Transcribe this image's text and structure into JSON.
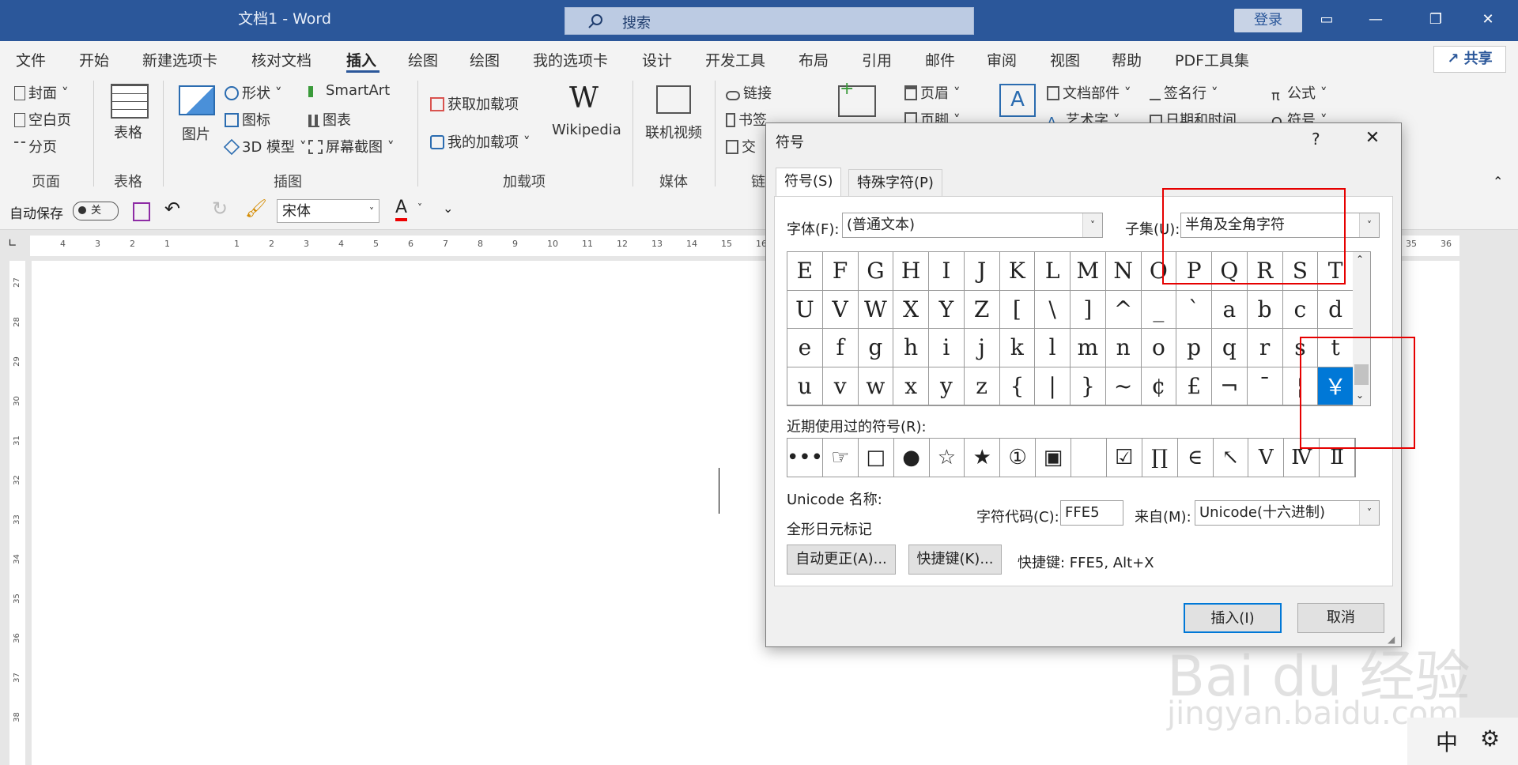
{
  "window": {
    "title": "文档1  -  Word",
    "search_placeholder": "搜索",
    "login": "登录",
    "share": "共享"
  },
  "ribbon": {
    "tabs": [
      "文件",
      "开始",
      "新建选项卡",
      "核对文档",
      "插入",
      "绘图",
      "绘图",
      "我的选项卡",
      "设计",
      "开发工具",
      "布局",
      "引用",
      "邮件",
      "审阅",
      "视图",
      "帮助",
      "PDF工具集"
    ],
    "active_tab": "插入",
    "pages_group": {
      "items": [
        "封面",
        "空白页",
        "分页"
      ],
      "label": "页面"
    },
    "table_group": {
      "item": "表格",
      "label": "表格"
    },
    "illus_group": {
      "picture": "图片",
      "shapes": "形状",
      "icons": "图标",
      "model3d": "3D 模型",
      "smartart": "SmartArt",
      "chart": "图表",
      "screenshot": "屏幕截图",
      "label": "插图"
    },
    "addins_group": {
      "get": "获取加载项",
      "mine": "我的加载项",
      "wiki": "Wikipedia",
      "label": "加载项"
    },
    "media_group": {
      "video": "联机视频",
      "label": "媒体"
    },
    "links_group": {
      "link": "链接",
      "bookmark": "书签",
      "cross": "交",
      "label": "链"
    },
    "header_group": {
      "header": "页眉",
      "footer": "页脚"
    },
    "text_group": {
      "parts": "文档部件",
      "wordart": "艺术字",
      "sign": "签名行",
      "datetime": "日期和时间"
    },
    "symbols_group": {
      "equation": "公式",
      "symbol": "符号"
    }
  },
  "qat": {
    "autosave": "自动保存",
    "toggle": "关",
    "font": "宋体"
  },
  "ruler": {
    "ticks": [
      "4",
      "3",
      "2",
      "1",
      "",
      "1",
      "2",
      "3",
      "4",
      "5",
      "6",
      "7",
      "8",
      "9",
      "10",
      "11",
      "12",
      "13",
      "14",
      "15",
      "16"
    ],
    "right_ticks": [
      "35",
      "36"
    ],
    "v_ticks": [
      "27",
      "28",
      "29",
      "30",
      "31",
      "32",
      "33",
      "34",
      "35",
      "36",
      "37",
      "38"
    ]
  },
  "dialog": {
    "title": "符号",
    "help": "?",
    "tabs": [
      "符号(S)",
      "特殊字符(P)"
    ],
    "font_label": "字体(F):",
    "font_value": "(普通文本)",
    "subset_label": "子集(U):",
    "subset_value": "半角及全角字符",
    "symbols": [
      "E",
      "F",
      "G",
      "H",
      "I",
      "J",
      "K",
      "L",
      "M",
      "N",
      "O",
      "P",
      "Q",
      "R",
      "S",
      "T",
      "U",
      "V",
      "W",
      "X",
      "Y",
      "Z",
      "[",
      "\\",
      "]",
      "^",
      "_",
      "`",
      "a",
      "b",
      "c",
      "d",
      "e",
      "f",
      "g",
      "h",
      "i",
      "j",
      "k",
      "l",
      "m",
      "n",
      "o",
      "p",
      "q",
      "r",
      "s",
      "t",
      "u",
      "v",
      "w",
      "x",
      "y",
      "z",
      "{",
      "|",
      "}",
      "~",
      "¢",
      "£",
      "¬",
      "¯",
      "¦",
      "￥"
    ],
    "selected_symbol": "￥",
    "recent_label": "近期使用过的符号(R):",
    "recent": [
      "•••",
      "☞",
      "□",
      "●",
      "☆",
      "★",
      "①",
      "▣",
      "",
      "☑",
      "∏",
      "∈",
      "↖",
      "Ⅴ",
      "Ⅳ",
      "Ⅱ"
    ],
    "unicode_label": "Unicode 名称:",
    "unicode_name": "全形日元标记",
    "charcode_label": "字符代码(C):",
    "charcode": "FFE5",
    "from_label": "来自(M):",
    "from_value": "Unicode(十六进制)",
    "autocorrect": "自动更正(A)...",
    "shortcut_btn": "快捷键(K)...",
    "shortcut_text": "快捷键: FFE5, Alt+X",
    "insert": "插入(I)",
    "cancel": "取消"
  },
  "watermark": {
    "logo": "Bai du 经验",
    "url": "jingyan.baidu.com"
  },
  "ime": {
    "mode": "中"
  }
}
